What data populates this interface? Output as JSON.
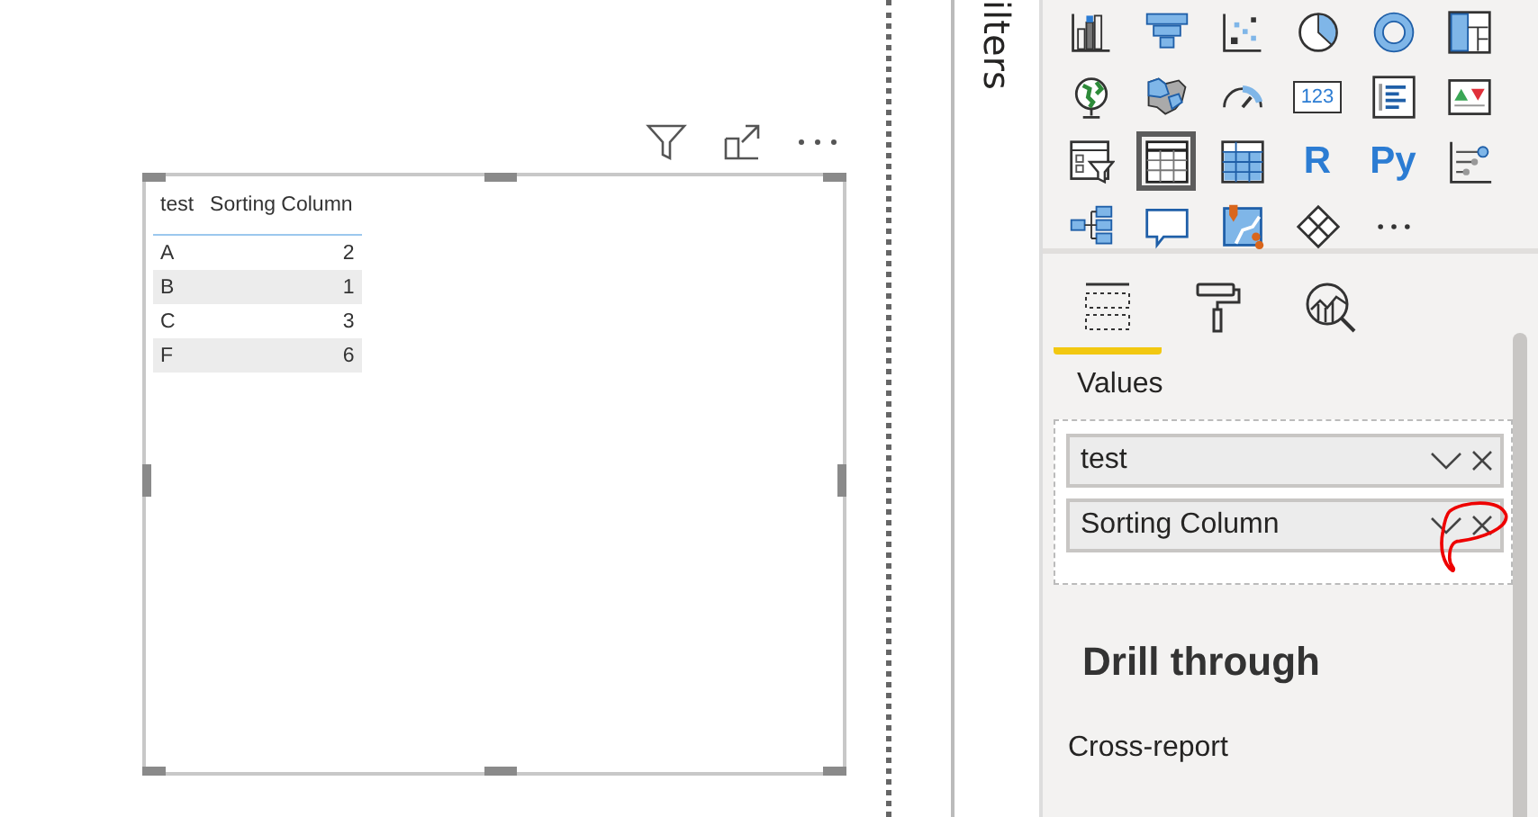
{
  "visual": {
    "columns": [
      "test",
      "Sorting Column"
    ],
    "rows": [
      [
        "A",
        "2"
      ],
      [
        "B",
        "1"
      ],
      [
        "C",
        "3"
      ],
      [
        "F",
        "6"
      ]
    ]
  },
  "filters_pane": {
    "title": "ilters"
  },
  "visualizations": [
    {
      "kind": "column",
      "selected": false
    },
    {
      "kind": "funnel",
      "selected": false
    },
    {
      "kind": "scatter",
      "selected": false
    },
    {
      "kind": "pie",
      "selected": false
    },
    {
      "kind": "donut",
      "selected": false
    },
    {
      "kind": "treemap",
      "selected": false
    },
    {
      "kind": "globe",
      "selected": false
    },
    {
      "kind": "map",
      "selected": false
    },
    {
      "kind": "gauge",
      "selected": false
    },
    {
      "kind": "card",
      "label": "123",
      "selected": false
    },
    {
      "kind": "list",
      "selected": false
    },
    {
      "kind": "kpi",
      "selected": false
    },
    {
      "kind": "slicer",
      "selected": false
    },
    {
      "kind": "table",
      "selected": true
    },
    {
      "kind": "matrix",
      "selected": false
    },
    {
      "kind": "text",
      "label": "R",
      "selected": false
    },
    {
      "kind": "text",
      "label": "Py",
      "selected": false
    },
    {
      "kind": "nodes",
      "selected": false
    },
    {
      "kind": "tree",
      "selected": false
    },
    {
      "kind": "bubble",
      "selected": false
    },
    {
      "kind": "pin",
      "selected": false
    },
    {
      "kind": "diamond",
      "selected": false
    },
    {
      "kind": "more",
      "selected": false
    }
  ],
  "pane_tabs": [
    {
      "kind": "fields",
      "selected": true
    },
    {
      "kind": "format",
      "selected": false
    },
    {
      "kind": "analytics",
      "selected": false
    }
  ],
  "values_label": "Values",
  "value_fields": [
    {
      "label": "test",
      "annotated": false
    },
    {
      "label": "Sorting Column",
      "annotated": true
    }
  ],
  "drill_through": {
    "title": "Drill through",
    "cross_report": "Cross-report"
  }
}
